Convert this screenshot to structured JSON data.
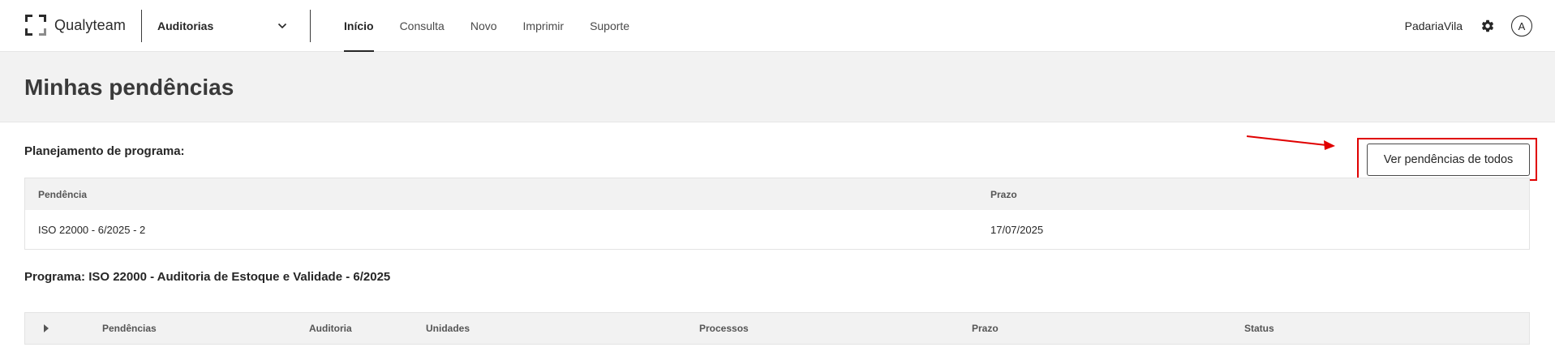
{
  "header": {
    "logo_text": "Qualyteam",
    "module_label": "Auditorias",
    "nav": [
      {
        "label": "Início",
        "active": true
      },
      {
        "label": "Consulta",
        "active": false
      },
      {
        "label": "Novo",
        "active": false
      },
      {
        "label": "Imprimir",
        "active": false
      },
      {
        "label": "Suporte",
        "active": false
      }
    ],
    "company": "PadariaVila",
    "avatar_initial": "A",
    "icons": {
      "settings": "gear-icon",
      "module_dropdown": "chevron-down-icon"
    }
  },
  "page": {
    "title": "Minhas pendências"
  },
  "planning": {
    "title": "Planejamento de programa:",
    "view_all_button": "Ver pendências de todos",
    "columns": [
      "Pendência",
      "Prazo"
    ],
    "rows": [
      {
        "pendencia": "ISO 22000 - 6/2025 - 2",
        "prazo": "17/07/2025"
      }
    ]
  },
  "program": {
    "title": "Programa: ISO 22000 - Auditoria de Estoque e Validade - 6/2025",
    "columns": [
      "Pendências",
      "Auditoria",
      "Unidades",
      "Processos",
      "Prazo",
      "Status"
    ]
  },
  "colors": {
    "accent": "#262626",
    "annotation": "#e00000",
    "band_bg": "#f2f2f2"
  }
}
